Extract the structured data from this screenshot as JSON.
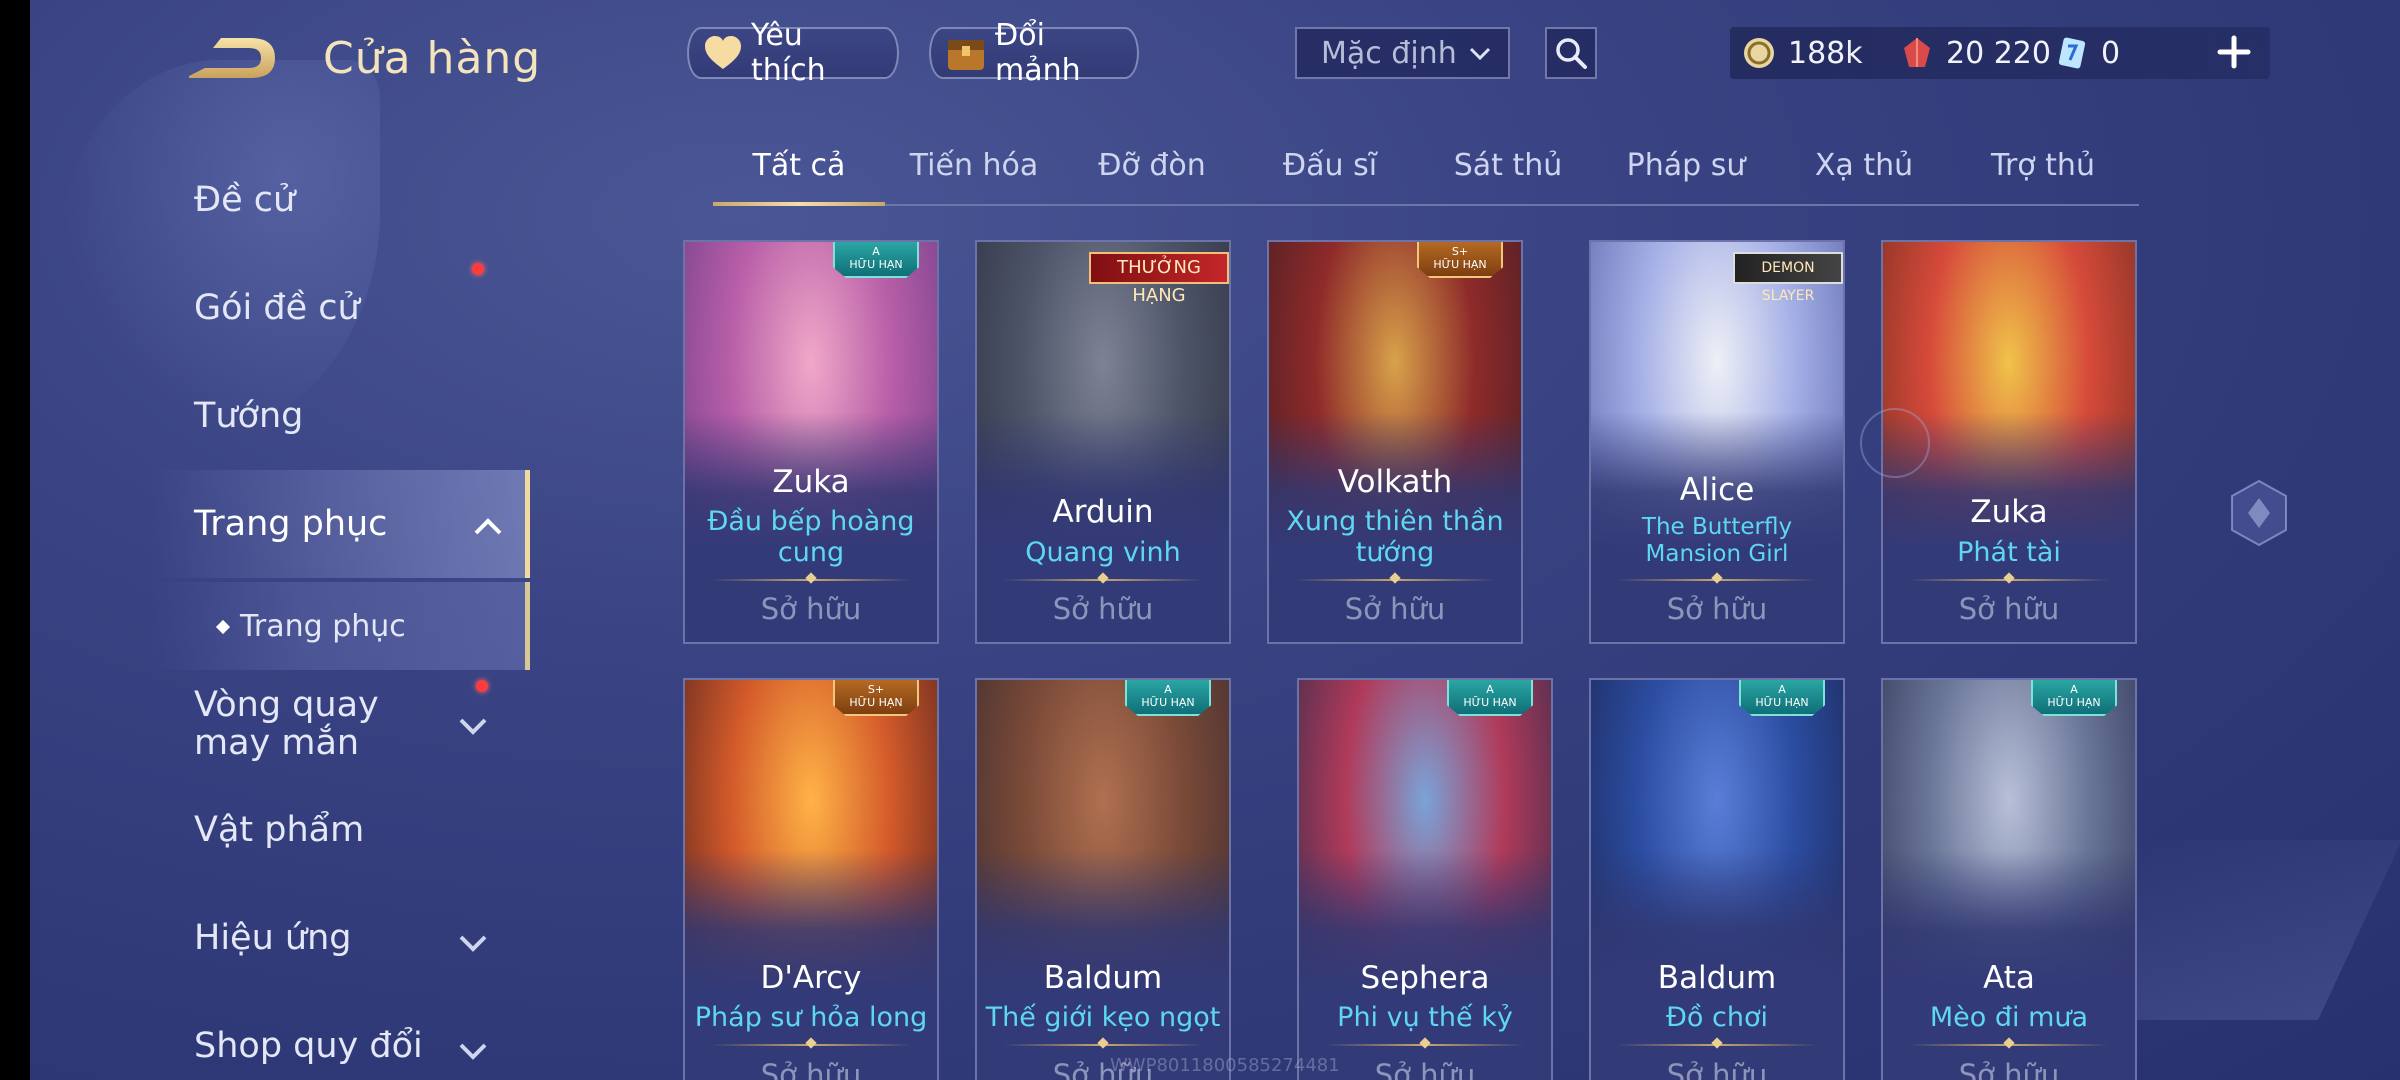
{
  "header": {
    "title": "Cửa hàng",
    "favorites_label": "Yêu thích",
    "exchange_label": "Đổi mảnh",
    "sort_selected": "Mặc định"
  },
  "currencies": {
    "gold": "188k",
    "voucher": "20 220",
    "ticket": "0"
  },
  "sidebar": {
    "items": [
      {
        "label": "Đề cử"
      },
      {
        "label": "Gói đề cử"
      },
      {
        "label": "Tướng"
      },
      {
        "label": "Trang phục"
      },
      {
        "label": "Trang phục"
      },
      {
        "label": "Vòng quay may mắn"
      },
      {
        "label": "Vật phẩm"
      },
      {
        "label": "Hiệu ứng"
      },
      {
        "label": "Shop quy đổi"
      }
    ]
  },
  "tabs": [
    "Tất cả",
    "Tiến hóa",
    "Đỡ đòn",
    "Đấu sĩ",
    "Sát thủ",
    "Pháp sư",
    "Xạ thủ",
    "Trợ thủ"
  ],
  "cards": [
    {
      "hero": "Zuka",
      "skin": "Đầu bếp hoàng cung",
      "status": "Sở hữu",
      "badge": "A\nHỮU HẠN",
      "colors": [
        "#f0a8c8",
        "#b85fa8",
        "#6a3a86"
      ]
    },
    {
      "hero": "Arduin",
      "skin": "Quang vinh",
      "status": "Sở hữu",
      "badge": "THƯỞNG HẠNG",
      "colors": [
        "#7d8294",
        "#4e5468",
        "#2b2f40"
      ]
    },
    {
      "hero": "Volkath",
      "skin": "Xung thiên thần tướng",
      "status": "Sở hữu",
      "badge": "S+\nHỮU HẠN",
      "colors": [
        "#d8a24a",
        "#8e2a2a",
        "#3e1d22"
      ]
    },
    {
      "hero": "Alice",
      "skin": "The Butterfly Mansion Girl",
      "status": "Sở hữu",
      "badge": "DEMON SLAYER",
      "colors": [
        "#eef0f6",
        "#a3aee6",
        "#5561a6"
      ]
    },
    {
      "hero": "Zuka",
      "skin": "Phát tài",
      "status": "Sở hữu",
      "badge": "",
      "colors": [
        "#f0c34a",
        "#d64a3a",
        "#6e2c1e"
      ]
    },
    {
      "hero": "D'Arcy",
      "skin": "Pháp sư hỏa long",
      "status": "Sở hữu",
      "badge": "S+\nHỮU HẠN",
      "colors": [
        "#ffb347",
        "#d35a2a",
        "#4a1e1e"
      ]
    },
    {
      "hero": "Baldum",
      "skin": "Thế giới kẹo ngọt",
      "status": "Sở hữu",
      "badge": "A\nHỮU HẠN",
      "colors": [
        "#b07050",
        "#7a4a38",
        "#3a2a30"
      ]
    },
    {
      "hero": "Sephera",
      "skin": "Phi vụ thế kỷ",
      "status": "Sở hữu",
      "badge": "A\nHỮU HẠN",
      "colors": [
        "#7aa3d8",
        "#b03a5a",
        "#2a2a4a"
      ]
    },
    {
      "hero": "Baldum",
      "skin": "Đồ chơi",
      "status": "Sở hữu",
      "badge": "A\nHỮU HẠN",
      "colors": [
        "#5a7ed8",
        "#2b4ca0",
        "#1c2450"
      ]
    },
    {
      "hero": "Ata",
      "skin": "Mèo đi mưa",
      "status": "Sở hữu",
      "badge": "A\nHỮU HẠN",
      "colors": [
        "#b8c0d8",
        "#6a7698",
        "#2a3050"
      ]
    }
  ],
  "watermark": "WWP8011800585274481"
}
